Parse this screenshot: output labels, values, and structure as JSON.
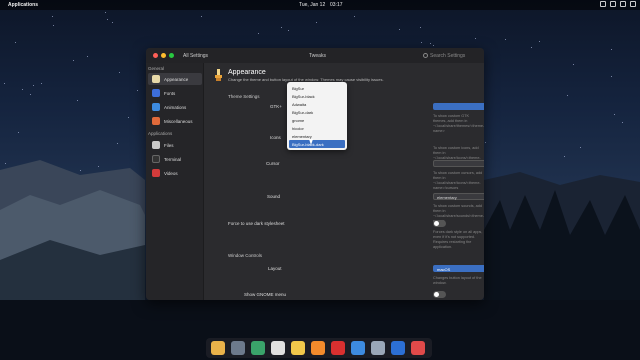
{
  "topbar": {
    "applications": "Applications",
    "date": "Tue, Jan 12",
    "time": "03:17"
  },
  "window": {
    "all_settings": "All Settings",
    "title": "Tweaks",
    "search_placeholder": "Search Settings"
  },
  "sidebar": {
    "general_header": "General",
    "items": [
      {
        "label": "Appearance",
        "icon": "appearance-icon",
        "color": "#e8d9a8"
      },
      {
        "label": "Fonts",
        "icon": "fonts-icon",
        "color": "#3d6edb"
      },
      {
        "label": "Animations",
        "icon": "animations-icon",
        "color": "#3d8be0"
      },
      {
        "label": "Miscellaneous",
        "icon": "misc-icon",
        "color": "#e06a3a"
      }
    ],
    "applications_header": "Applications",
    "apps": [
      {
        "label": "Files",
        "icon": "files-icon",
        "color": "#c9c9c9"
      },
      {
        "label": "Terminal",
        "icon": "terminal-icon",
        "color": "#333"
      },
      {
        "label": "Videos",
        "icon": "videos-icon",
        "color": "#d33b3b"
      }
    ]
  },
  "content": {
    "title": "Appearance",
    "subtitle": "Change the theme and button layout of the window. Themes may cause visibility issues.",
    "theme_settings": "Theme Settings",
    "gtk_label": "GTK+",
    "icons_label": "Icons",
    "cursor_label": "Cursor",
    "sound_label": "Sound",
    "sound_value": "elementary",
    "gtk_hint": "To show custom GTK themes, add them in ~/.local/share/themes/<theme-name>",
    "icons_hint": "To show custom icons, add them in ~/.local/share/icons/<theme-name>",
    "cursor_hint": "To show custom cursors, add them in ~/.local/share/icons/<theme-name>/cursors",
    "sound_hint": "To show custom sounds, add them in ~/.local/share/sounds/<theme-name>",
    "force_dark_label": "Force to use dark stylesheet",
    "force_dark_hint": "Forces dark style on all apps, even if it's not supported. Requires restarting the application.",
    "window_controls": "Window Controls",
    "layout_label": "Layout",
    "layout_value": "macOS",
    "layout_hint": "Changes button layout of the window.",
    "gnome_menu_label": "Show GNOME menu"
  },
  "dropdown": {
    "options": [
      "BigSur",
      "BigSur-black",
      "Adwaita",
      "BigSur-dark",
      "gnome",
      "hicolor",
      "elementary",
      "BigSur-black-dark"
    ],
    "selected": "BigSur-black-dark"
  },
  "dock": {
    "icons": [
      {
        "name": "files-icon",
        "color": "#e9b24a"
      },
      {
        "name": "videos-icon",
        "color": "#6d7a8c"
      },
      {
        "name": "browser-icon",
        "color": "#3aa36a"
      },
      {
        "name": "mail-icon",
        "color": "#e0e0e0"
      },
      {
        "name": "calendar-icon",
        "color": "#f1c84b"
      },
      {
        "name": "music-icon",
        "color": "#f38b2c"
      },
      {
        "name": "photos-icon",
        "color": "#d93030"
      },
      {
        "name": "appcenter-icon",
        "color": "#3d8be0"
      },
      {
        "name": "settings-icon",
        "color": "#9aa7b8"
      },
      {
        "name": "terminal-icon",
        "color": "#2c6fd4"
      },
      {
        "name": "system-icon",
        "color": "#e04a4a"
      }
    ]
  }
}
